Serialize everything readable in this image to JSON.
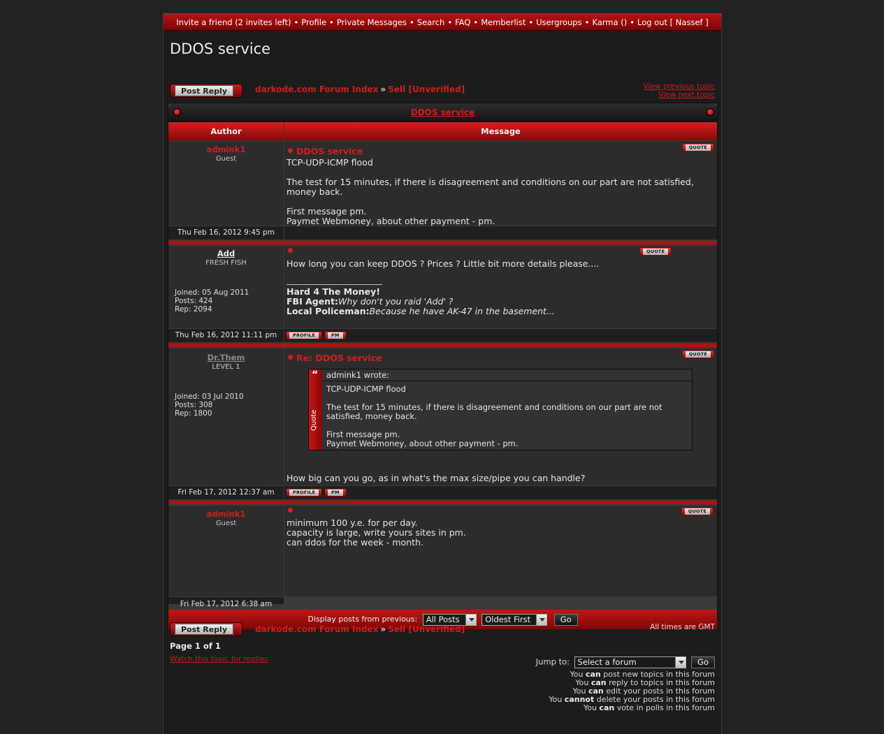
{
  "topnav": {
    "items": [
      "Invite a friend (2 invites left)",
      "Profile",
      "Private Messages",
      "Search",
      "FAQ",
      "Memberlist",
      "Usergroups",
      "Karma ()",
      "Log out [ Nassef ]"
    ],
    "separator": "•"
  },
  "page_title": "DDOS service",
  "post_reply_label": "Post Reply",
  "breadcrumb": {
    "forum_index": "darkode.com Forum Index",
    "arrow": "»",
    "forum": "Sell [Unverified]"
  },
  "topic_nav": {
    "previous": "View previous topic",
    "next": "View next topic"
  },
  "table": {
    "title": "DDOS service",
    "author_header": "Author",
    "message_header": "Message"
  },
  "posts": [
    {
      "author": "admink1",
      "author_color": "#cf1d1d",
      "rank": "Guest",
      "stats": [],
      "date": "Thu Feb 16, 2012 9:45 pm",
      "title": "DDOS service",
      "body": "TCP-UDP-ICMP flood\n\nThe test for 15 minutes, if there is disagreement and conditions on our part are not satisfied, money back.\n\nFirst message pm.\nPaymet Webmoney, about other payment - pm.",
      "has_profile_pm": false
    },
    {
      "author": "Add",
      "author_color": "#e6e6e6",
      "rank": "FRESH FISH",
      "stats": [
        "Joined: 05 Aug 2011",
        "Posts: 424",
        "Rep: 2094"
      ],
      "date": "Thu Feb 16, 2012 11:11 pm",
      "title": "",
      "body": "How long you can keep DDOS ? Prices ? Little bit more details please....",
      "signature": {
        "line1_bold": "Hard 4 The Money!",
        "line2_bold": "FBI Agent:",
        "line2_italic": "Why don't you raid 'Add' ?",
        "line3_bold": "Local Policeman:",
        "line3_italic": "Because he have AK-47 in the basement..."
      },
      "has_profile_pm": true
    },
    {
      "author": "Dr.Them",
      "author_color": "#8a8a8a",
      "rank": "LEVEL 1",
      "stats": [
        "Joined: 03 Jul 2010",
        "Posts: 308",
        "Rep: 1800"
      ],
      "date": "Fri Feb 17, 2012 12:37 am",
      "title": "Re: DDOS service",
      "quote": {
        "wrote": "admink1 wrote:",
        "label": "Quote",
        "text": "TCP-UDP-ICMP flood\n\nThe test for 15 minutes, if there is disagreement and conditions on our part are not satisfied, money back.\n\nFirst message pm.\nPaymet Webmoney, about other payment - pm."
      },
      "body": "How big can you go, as in what's the max size/pipe you can handle?",
      "has_profile_pm": true
    },
    {
      "author": "admink1",
      "author_color": "#cf1d1d",
      "rank": "Guest",
      "stats": [],
      "date": "Fri Feb 17, 2012 6:38 am",
      "title": "",
      "body": "minimum 100 y.e. for per day.\ncapacity is large, write yours sites in pm.\ncan ddos for the week - month.",
      "has_profile_pm": false
    }
  ],
  "buttons": {
    "quote": "QUOTE",
    "profile": "PROFILE",
    "pm": "PM"
  },
  "display_bar": {
    "label": "Display posts from previous:",
    "posts_select": "All Posts",
    "order_select": "Oldest First",
    "go": "Go"
  },
  "timezone": "All times are GMT",
  "pagination": "Page 1 of 1",
  "watch_link": "Watch this topic for replies",
  "jump": {
    "label": "Jump to:",
    "select": "Select a forum",
    "go": "Go"
  },
  "permissions": [
    {
      "pre": "You ",
      "verb": "can",
      "post": " post new topics in this forum"
    },
    {
      "pre": "You ",
      "verb": "can",
      "post": " reply to topics in this forum"
    },
    {
      "pre": "You ",
      "verb": "can",
      "post": " edit your posts in this forum"
    },
    {
      "pre": "You ",
      "verb": "cannot",
      "post": " delete your posts in this forum"
    },
    {
      "pre": "You ",
      "verb": "can",
      "post": " vote in polls in this forum"
    }
  ]
}
